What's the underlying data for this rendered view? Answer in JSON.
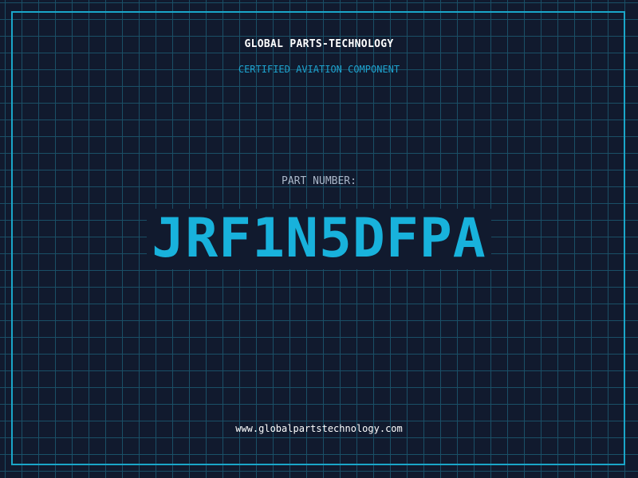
{
  "header": {
    "company": "GLOBAL PARTS-TECHNOLOGY",
    "subtitle": "CERTIFIED AVIATION COMPONENT"
  },
  "part": {
    "label": "PART NUMBER:",
    "number": "JRF1N5DFPA"
  },
  "footer": {
    "url": "www.globalpartstechnology.com"
  },
  "colors": {
    "background": "#111a2e",
    "grid": "#1a4f66",
    "frame": "#1aa6c9",
    "accent": "#18b2dc",
    "text": "#ffffff",
    "label": "#aab6c8"
  }
}
